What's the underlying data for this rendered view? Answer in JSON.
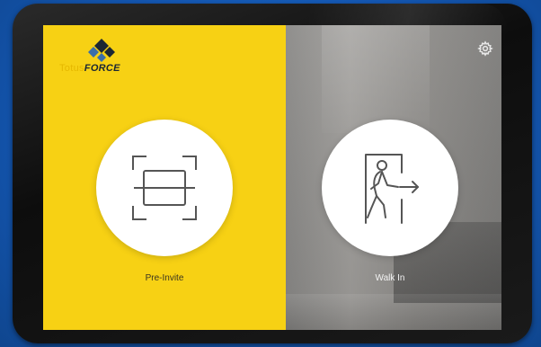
{
  "brand": {
    "name_light": "Totus",
    "name_bold": "FORCE"
  },
  "options": {
    "pre_invite_label": "Pre-Invite",
    "walk_in_label": "Walk In"
  },
  "icons": {
    "pre_invite": "qr-scan-icon",
    "walk_in": "walk-in-door-icon",
    "settings": "gear-icon",
    "logo": "logo-diamond-icon"
  },
  "colors": {
    "yellow_panel": "#f7d114",
    "page_background": "#1457b3",
    "tablet_bezel": "#111111"
  }
}
